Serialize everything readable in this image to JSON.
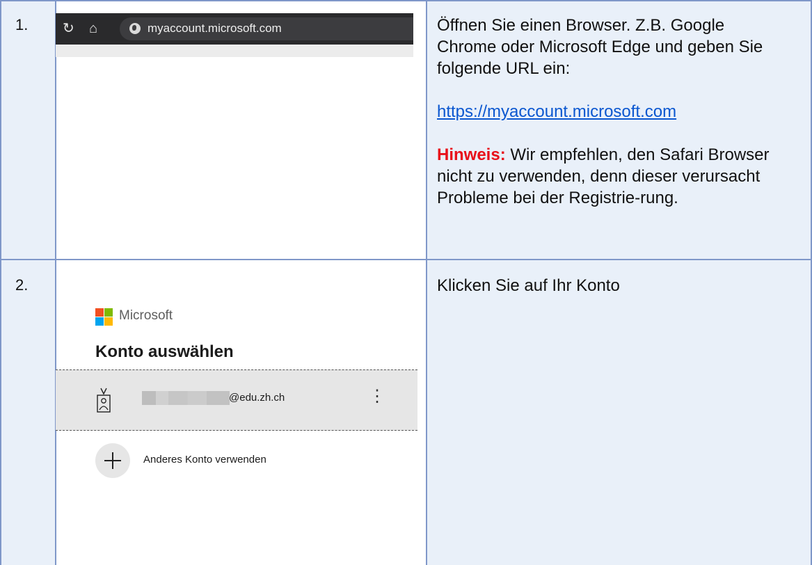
{
  "rows": [
    {
      "number": "1.",
      "browser": {
        "url": "myaccount.microsoft.com",
        "reload_icon": "reload-icon",
        "home_icon": "home-icon",
        "site_icon": "globe-icon"
      },
      "instruction": {
        "line1": "Öffnen Sie einen Browser. Z.B. Google Chrome oder Microsoft Edge und geben Sie folgende URL ein:",
        "link": "https://myaccount.microsoft.com",
        "hint_label": "Hinweis:",
        "hint_text": " Wir empfehlen, den Safari Browser nicht zu verwenden, denn dieser verursacht Probleme bei der Registrie-rung."
      }
    },
    {
      "number": "2.",
      "ms": {
        "brand": "Microsoft",
        "heading": "Konto auswählen",
        "account_email": "@edu.zh.ch",
        "more_icon": "more-options-icon",
        "add_label": "Anderes Konto verwenden"
      },
      "instruction": {
        "line1": "Klicken Sie auf Ihr Konto"
      }
    }
  ],
  "colors": {
    "border": "#7f97c9",
    "cell_blue": "#e9f0f9",
    "link": "#0b57d0",
    "hint": "#e8101a"
  }
}
